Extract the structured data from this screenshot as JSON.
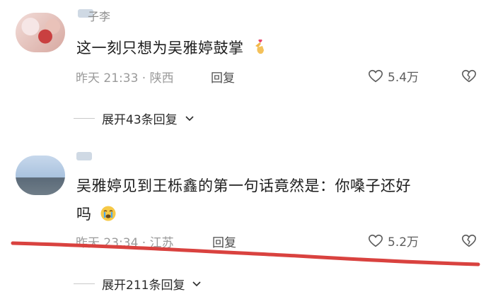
{
  "comments": [
    {
      "username": "子李",
      "text": "这一刻只想为吴雅婷鼓掌",
      "emoji": "finger-heart-emoji",
      "meta": "昨天 21:33 · 陕西",
      "reply_label": "回复",
      "likes": "5.4万",
      "expand_label": "展开43条回复"
    },
    {
      "username": "",
      "text_line1": "吴雅婷见到王栎鑫的第一句话竟然是：你嗓子还好",
      "text_line2": "吗",
      "emoji": "crying-face-emoji",
      "meta": "昨天 23:34 · 江苏",
      "reply_label": "回复",
      "likes": "5.2万",
      "expand_label": "展开211条回复"
    }
  ],
  "colors": {
    "annotation_line": "#d9423f",
    "meta_text": "#9a9a9a"
  },
  "icons": [
    "heart-outline-icon",
    "broken-heart-icon",
    "chevron-down-icon"
  ]
}
